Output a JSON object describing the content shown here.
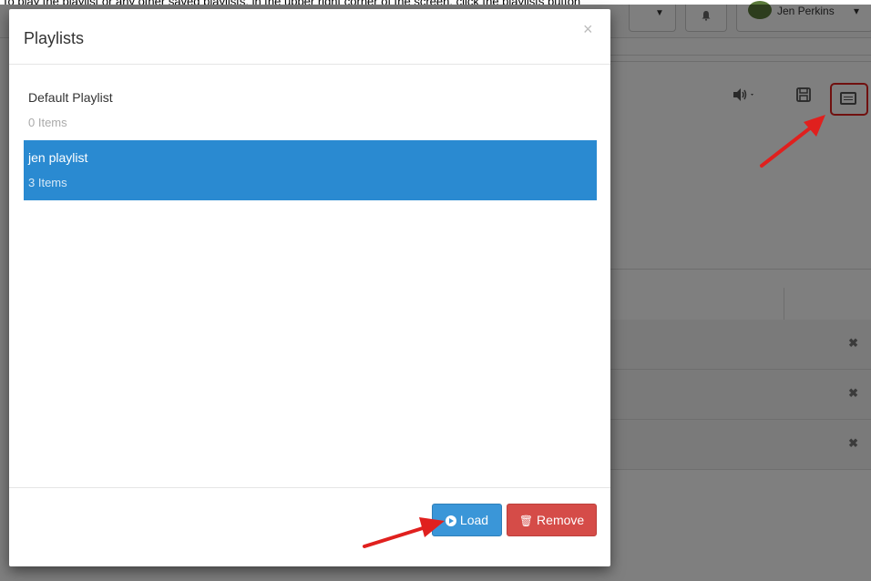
{
  "caption": "To play the playlist or any other saved playlists, in the upper right corner of the screen, click the playlists button",
  "app": {
    "user_name": "Jen Perkins",
    "user_caret": "▾",
    "bell_icon": "bell-icon",
    "volume_caret": "▾",
    "row_remove_glyph": "✖"
  },
  "modal": {
    "title": "Playlists",
    "close_glyph": "×",
    "playlists": [
      {
        "name": "Default Playlist",
        "count": "0 Items",
        "selected": false
      },
      {
        "name": "jen playlist",
        "count": "3 Items",
        "selected": true
      }
    ],
    "load_label": "Load",
    "remove_label": "Remove"
  },
  "colors": {
    "selected_bg": "#2a8ad1",
    "load_btn": "#3a96d8",
    "remove_btn": "#d54c48",
    "annotation": "#e0201e"
  }
}
